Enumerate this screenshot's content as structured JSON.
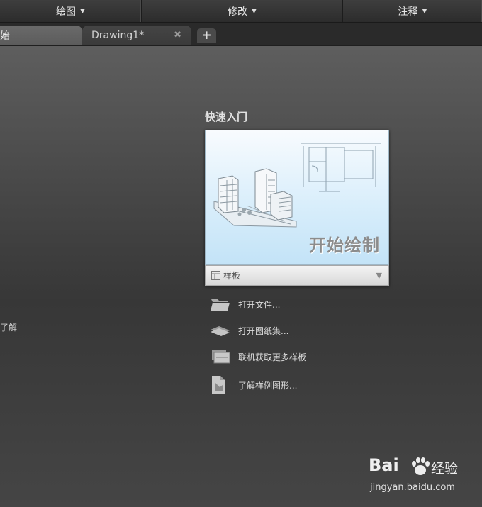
{
  "ribbon": {
    "panels": [
      {
        "label": "绘图"
      },
      {
        "label": "修改"
      },
      {
        "label": "注释"
      }
    ]
  },
  "tabs": {
    "start_label": "始",
    "drawing_label": "Drawing1*",
    "close_glyph": "✖",
    "new_glyph": "+"
  },
  "left": {
    "learn_label": "了解"
  },
  "quick_start": {
    "title": "快速入门",
    "card_headline": "开始绘制",
    "template_label": "样板",
    "template_dropdown": "▼",
    "actions": [
      {
        "label": "打开文件...",
        "icon": "folder-icon"
      },
      {
        "label": "打开图纸集...",
        "icon": "sheet-set-icon"
      },
      {
        "label": "联机获取更多样板",
        "icon": "templates-online-icon"
      },
      {
        "label": "了解样例图形...",
        "icon": "sample-drawing-icon"
      }
    ]
  },
  "watermark": {
    "brand": "Bai",
    "cn": "经验",
    "url": "jingyan.baidu.com"
  }
}
